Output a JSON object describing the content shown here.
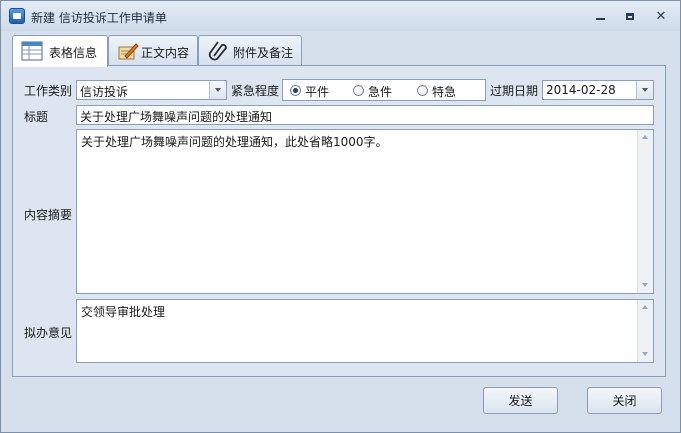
{
  "window": {
    "title": "新建 信访投诉工作申请单"
  },
  "tabs": [
    {
      "label": "表格信息",
      "icon": "table-icon",
      "active": true
    },
    {
      "label": "正文内容",
      "icon": "pen-edit-icon",
      "active": false
    },
    {
      "label": "附件及备注",
      "icon": "paperclip-icon",
      "active": false
    }
  ],
  "form": {
    "work_type": {
      "label": "工作类别",
      "value": "信访投诉"
    },
    "urgency": {
      "label": "紧急程度",
      "options": [
        "平件",
        "急件",
        "特急"
      ],
      "selected": "平件"
    },
    "due_date": {
      "label": "过期日期",
      "value": "2014-02-28"
    },
    "title": {
      "label": "标题",
      "value": "关于处理广场舞噪声问题的处理通知"
    },
    "summary": {
      "label": "内容摘要",
      "value": "关于处理广场舞噪声问题的处理通知，此处省略1000字。"
    },
    "opinion": {
      "label": "拟办意见",
      "value": "交领导审批处理"
    }
  },
  "buttons": {
    "send": "发送",
    "close": "关闭"
  },
  "colors": {
    "window_bg": "#d6e0ed",
    "panel_bg": "#dce5f0",
    "border": "#8c9fb9"
  }
}
